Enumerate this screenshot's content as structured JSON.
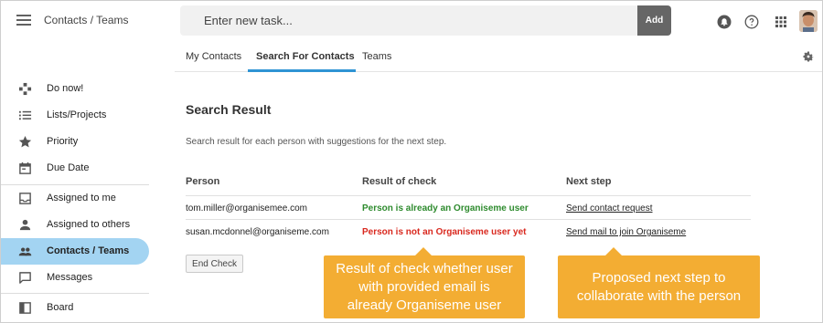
{
  "header": {
    "app_title": "Contacts / Teams",
    "task_placeholder": "Enter new task...",
    "add_label": "Add"
  },
  "tabs": [
    {
      "label": "My Contacts",
      "active": false
    },
    {
      "label": "Search For Contacts",
      "active": true
    },
    {
      "label": "Teams",
      "active": false
    }
  ],
  "sidebar": {
    "items": [
      {
        "label": "Do now!",
        "icon": "gamepad-icon"
      },
      {
        "label": "Lists/Projects",
        "icon": "list-icon"
      },
      {
        "label": "Priority",
        "icon": "star-icon"
      },
      {
        "label": "Due Date",
        "icon": "calendar-icon"
      },
      {
        "label": "Assigned to me",
        "icon": "inbox-icon"
      },
      {
        "label": "Assigned to others",
        "icon": "person-icon"
      },
      {
        "label": "Contacts / Teams",
        "icon": "people-icon",
        "active": true
      },
      {
        "label": "Messages",
        "icon": "message-icon"
      },
      {
        "label": "Board",
        "icon": "board-icon"
      }
    ]
  },
  "main": {
    "title": "Search Result",
    "description": "Search result for each person with suggestions for the next step.",
    "columns": [
      "Person",
      "Result of check",
      "Next step"
    ],
    "rows": [
      {
        "person": "tom.miller@organisemee.com",
        "result": "Person is already an Organiseme user",
        "result_status": "success",
        "next_step": "Send contact request"
      },
      {
        "person": "susan.mcdonnel@organiseme.com",
        "result": "Person is not an Organiseme user yet",
        "result_status": "error",
        "next_step": "Send mail to join Organiseme"
      }
    ],
    "end_check_label": "End Check"
  },
  "callouts": [
    {
      "lines": [
        "Result of check whether user",
        "with provided email is",
        "already Organiseme user"
      ]
    },
    {
      "lines": [
        "Proposed next step to",
        "collaborate with the person"
      ]
    }
  ],
  "colors": {
    "accent": "#2f94d4",
    "active_nav": "#a3d4f2",
    "success": "#2e8b2e",
    "error": "#d9281e",
    "callout": "#f3ad33",
    "add_button": "#666666"
  }
}
